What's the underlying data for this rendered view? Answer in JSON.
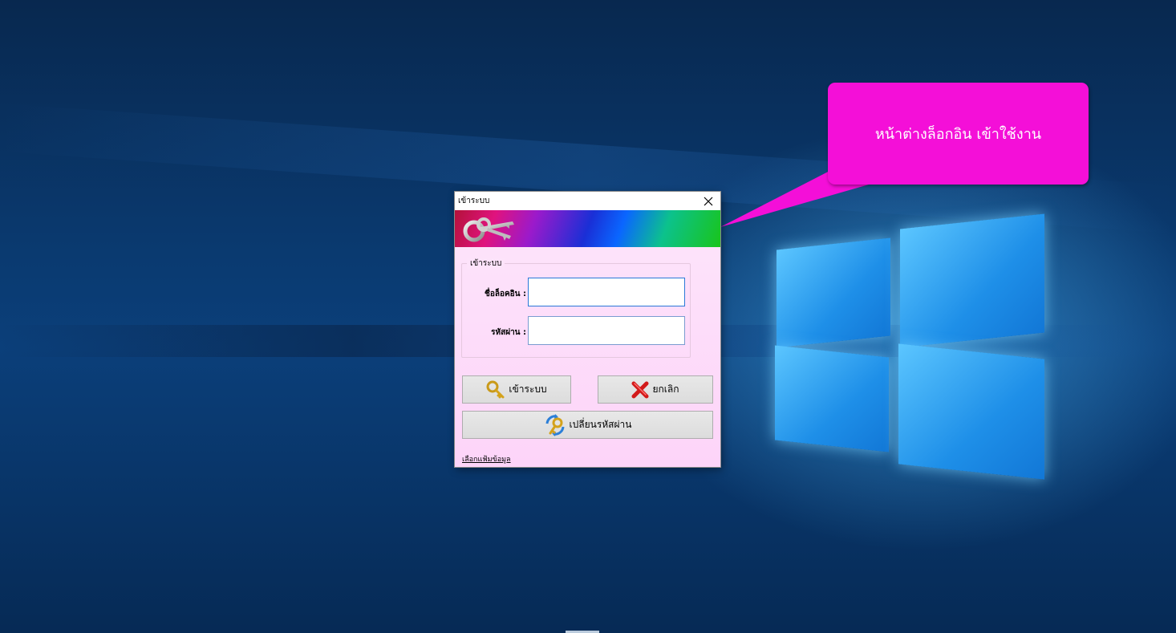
{
  "callout": {
    "text": "หน้าต่างล็อกอิน เข้าใช้งาน",
    "color": "#f40fd8"
  },
  "dialog": {
    "title": "เข้าระบบ",
    "group_label": "เข้าระบบ",
    "username_label": "ชื่อล็อคอิน :",
    "username_value": "",
    "password_label": "รหัสผ่าน :",
    "password_value": "",
    "login_button": "เข้าระบบ",
    "cancel_button": "ยกเลิก",
    "change_password_button": "เปลี่ยนรหัสผ่าน",
    "select_data_link": "เลือกแฟ้มข้อมูล",
    "icons": {
      "close": "close-icon",
      "banner": "keys-icon",
      "login": "key-search-icon",
      "cancel": "red-x-icon",
      "change_password": "key-refresh-icon"
    }
  }
}
